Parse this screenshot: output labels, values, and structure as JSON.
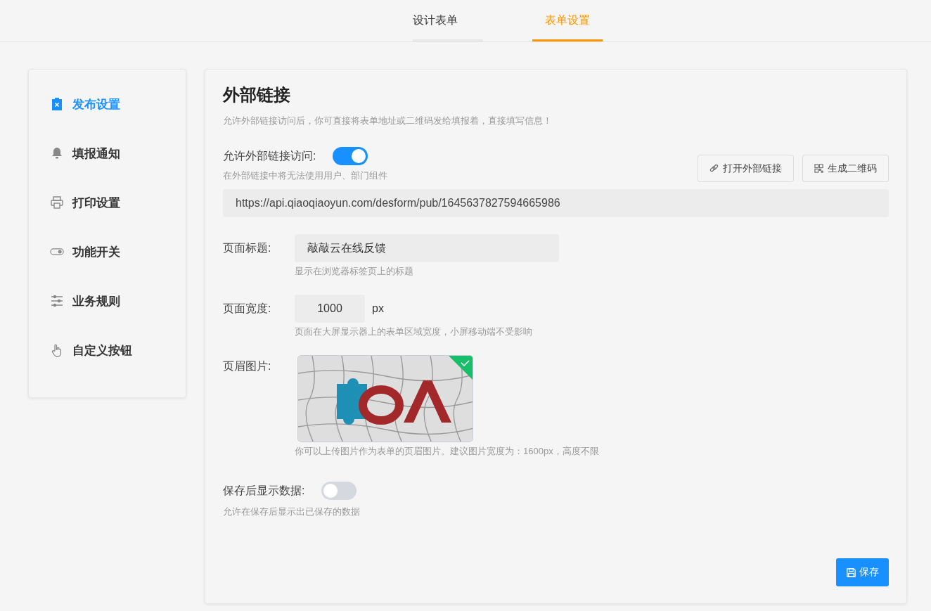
{
  "tabs": [
    {
      "label": "设计表单",
      "selected": false
    },
    {
      "label": "表单设置",
      "selected": true
    }
  ],
  "sidebar": {
    "items": [
      {
        "label": "发布设置",
        "selected": true
      },
      {
        "label": "填报通知",
        "selected": false
      },
      {
        "label": "打印设置",
        "selected": false
      },
      {
        "label": "功能开关",
        "selected": false
      },
      {
        "label": "业务规则",
        "selected": false
      },
      {
        "label": "自定义按钮",
        "selected": false
      }
    ]
  },
  "panel": {
    "title": "外部链接",
    "description": "允许外部链接访问后，你可直接将表单地址或二维码发给填报着，直接填写信息！",
    "external_access": {
      "label": "允许外部链接访问:",
      "on": true,
      "hint": "在外部链接中将无法使用用户、部门组件"
    },
    "buttons": [
      "打开外部链接",
      "生成二维码"
    ],
    "url": "https://api.qiaoqiaoyun.com/desform/pub/1645637827594665986",
    "page_title": {
      "label": "页面标题:",
      "value": "敲敲云在线反馈",
      "hint": "显示在浏览器标签页上的标题"
    },
    "page_width": {
      "label": "页面宽度:",
      "value": "1000",
      "unit": "px",
      "hint": "页面在大屏显示器上的表单区域宽度，小屏移动端不受影响"
    },
    "header_image": {
      "label": "页眉图片:",
      "kind": "picture",
      "selected": true,
      "hint": "你可以上传图片作为表单的页眉图片。建议图片宽度为：1600px，高度不限"
    },
    "show_data": {
      "label": "保存后显示数据:",
      "on": false,
      "hint": "允许在保存后显示出已保存的数据"
    },
    "save_button": "保存"
  }
}
